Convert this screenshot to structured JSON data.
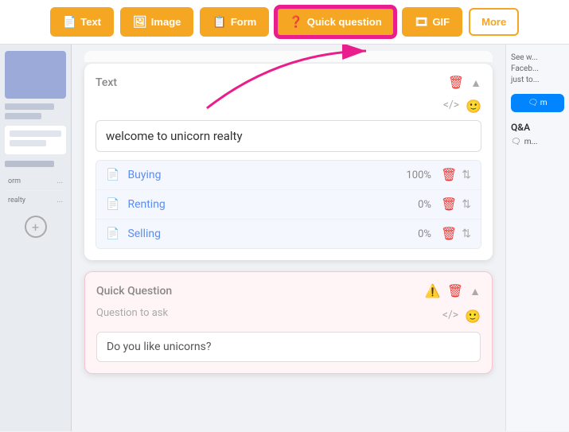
{
  "toolbar": {
    "buttons": [
      {
        "id": "text",
        "label": "Text",
        "icon": "📄",
        "active": false,
        "outline": false
      },
      {
        "id": "image",
        "label": "Image",
        "icon": "🖼",
        "active": false,
        "outline": false
      },
      {
        "id": "form",
        "label": "Form",
        "icon": "📋",
        "active": false,
        "outline": false
      },
      {
        "id": "quick-question",
        "label": "Quick question",
        "icon": "❓",
        "active": true,
        "outline": false
      },
      {
        "id": "gif",
        "label": "GIF",
        "icon": "🎞",
        "active": false,
        "outline": false
      },
      {
        "id": "more",
        "label": "More",
        "icon": "",
        "active": false,
        "outline": true
      }
    ]
  },
  "text_card": {
    "title": "Text",
    "text_value": "welcome to unicorn realty",
    "options": [
      {
        "label": "Buying",
        "percent": "100%"
      },
      {
        "label": "Renting",
        "percent": "0%"
      },
      {
        "label": "Selling",
        "percent": "0%"
      }
    ]
  },
  "quick_question_card": {
    "title": "Quick Question",
    "subtitle": "Question to ask",
    "input_value": "Do you like unicorns?"
  },
  "right_sidebar": {
    "text": "See w... Faceb... just to...",
    "messenger_label": "🗨 m",
    "qa_label": "Q&A",
    "qa_item": "🗨 m..."
  }
}
